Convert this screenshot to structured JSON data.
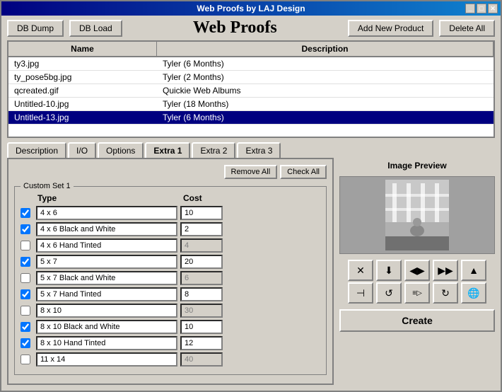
{
  "window": {
    "title": "Web Proofs by LAJ Design"
  },
  "toolbar": {
    "db_dump": "DB Dump",
    "db_load": "DB Load",
    "app_title": "Web Proofs",
    "add_new_product": "Add New Product",
    "delete_all": "Delete All"
  },
  "table": {
    "col_name": "Name",
    "col_description": "Description",
    "rows": [
      {
        "name": "ty3.jpg",
        "description": "Tyler (6 Months)",
        "selected": false
      },
      {
        "name": "ty_pose5bg.jpg",
        "description": "Tyler (2 Months)",
        "selected": false
      },
      {
        "name": "qcreated.gif",
        "description": "Quickie Web Albums",
        "selected": false
      },
      {
        "name": "Untitled-10.jpg",
        "description": "Tyler (18 Months)",
        "selected": false
      },
      {
        "name": "Untitled-13.jpg",
        "description": "Tyler (6 Months)",
        "selected": true
      }
    ]
  },
  "tabs": [
    {
      "label": "Description",
      "active": false
    },
    {
      "label": "I/O",
      "active": false
    },
    {
      "label": "Options",
      "active": false
    },
    {
      "label": "Extra 1",
      "active": true
    },
    {
      "label": "Extra 2",
      "active": false
    },
    {
      "label": "Extra 3",
      "active": false
    }
  ],
  "custom_set": {
    "label": "Custom Set 1",
    "remove_all": "Remove All",
    "check_all": "Check All",
    "col_type": "Type",
    "col_cost": "Cost",
    "products": [
      {
        "checked": true,
        "name": "4 x 6",
        "cost": "10",
        "disabled": false
      },
      {
        "checked": true,
        "name": "4 x 6 Black and White",
        "cost": "2",
        "disabled": false
      },
      {
        "checked": false,
        "name": "4 x 6 Hand Tinted",
        "cost": "4",
        "disabled": true
      },
      {
        "checked": true,
        "name": "5 x 7",
        "cost": "20",
        "disabled": false
      },
      {
        "checked": false,
        "name": "5 x 7 Black and White",
        "cost": "6",
        "disabled": true
      },
      {
        "checked": true,
        "name": "5 x 7 Hand Tinted",
        "cost": "8",
        "disabled": false
      },
      {
        "checked": false,
        "name": "8 x 10",
        "cost": "30",
        "disabled": true
      },
      {
        "checked": true,
        "name": "8 x 10 Black and White",
        "cost": "10",
        "disabled": false
      },
      {
        "checked": true,
        "name": "8 x 10 Hand Tinted",
        "cost": "12",
        "disabled": false
      },
      {
        "checked": false,
        "name": "11 x 14",
        "cost": "40",
        "disabled": true
      }
    ]
  },
  "image_preview": {
    "label": "Image Preview"
  },
  "icons": {
    "row1": [
      "✕",
      "⬇",
      "◁▷",
      "▷▷",
      "△"
    ],
    "row2": [
      "⊣",
      "↺",
      "≡▷",
      "↻",
      "🌐"
    ]
  },
  "create_btn": "Create"
}
